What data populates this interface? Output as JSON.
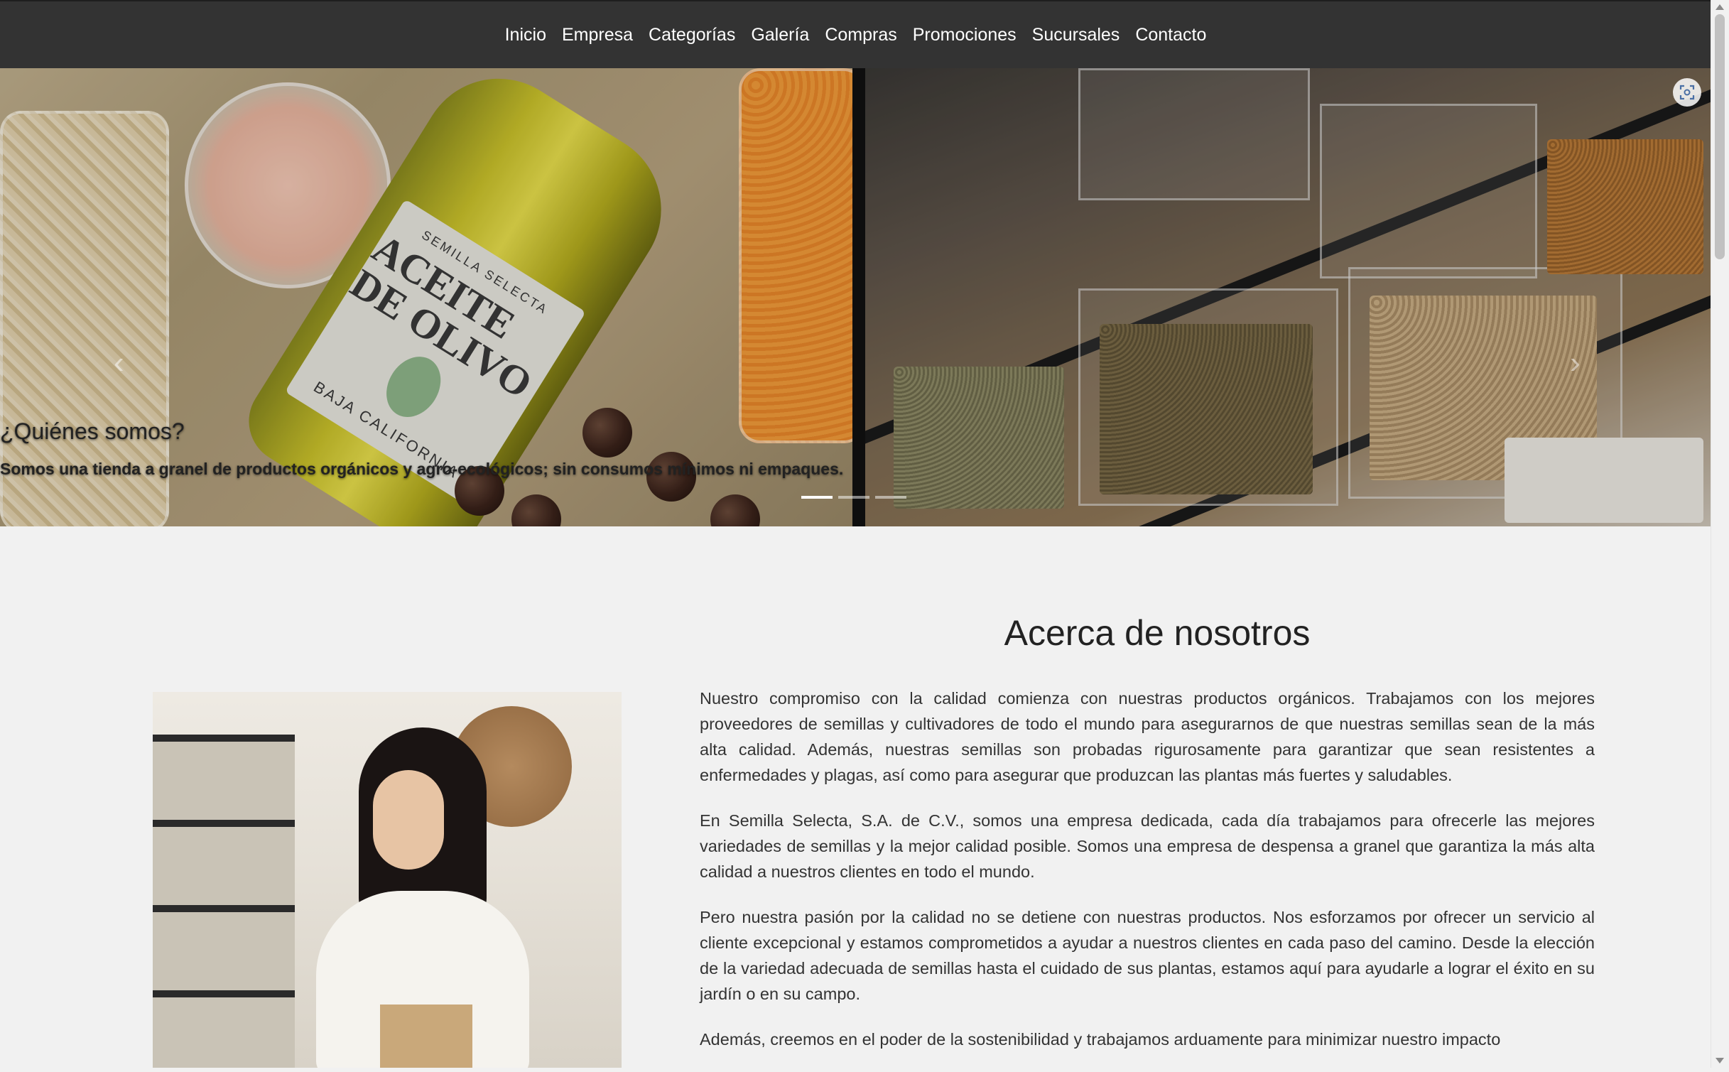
{
  "nav": {
    "items": [
      "Inicio",
      "Empresa",
      "Categorías",
      "Galería",
      "Compras",
      "Promociones",
      "Sucursales",
      "Contacto"
    ]
  },
  "hero": {
    "bottle_label": {
      "brand": "SEMILLA SELECTA",
      "product": "ACEITE DE OLIVO",
      "origin": "BAJA CALIFORNIA"
    },
    "caption_title": "¿Quiénes somos?",
    "caption_text": "Somos una tienda a granel de productos orgánicos y agro-ecológicos; sin consumos mínimos ni empaques.",
    "slides": 3,
    "active_slide": 1,
    "icons": {
      "lens": "lens-icon"
    }
  },
  "about": {
    "title": "Acerca de nosotros",
    "paragraphs": [
      "Nuestro compromiso con la calidad comienza con nuestras productos orgánicos. Trabajamos con los mejores proveedores de semillas y cultivadores de todo el mundo para asegurarnos de que nuestras semillas sean de la más alta calidad. Además, nuestras semillas son probadas rigurosamente para garantizar que sean resistentes a enfermedades y plagas, así como para asegurar que produzcan las plantas más fuertes y saludables.",
      "En Semilla Selecta, S.A. de C.V., somos una empresa dedicada, cada día trabajamos para ofrecerle las mejores variedades de semillas y la mejor calidad posible. Somos una empresa de despensa a granel que garantiza la más alta calidad a nuestros clientes en todo el mundo.",
      "Pero nuestra pasión por la calidad no se detiene con nuestras productos. Nos esforzamos por ofrecer un servicio al cliente excepcional y estamos comprometidos a ayudar a nuestros clientes en cada paso del camino. Desde la elección de la variedad adecuada de semillas hasta el cuidado de sus plantas, estamos aquí para ayudarle a lograr el éxito en su jardín o en su campo.",
      "Además, creemos en el poder de la sostenibilidad y trabajamos arduamente para minimizar nuestro impacto"
    ]
  },
  "colors": {
    "navbar": "#333333",
    "page_background": "#f1f1f1",
    "text": "#333333"
  }
}
